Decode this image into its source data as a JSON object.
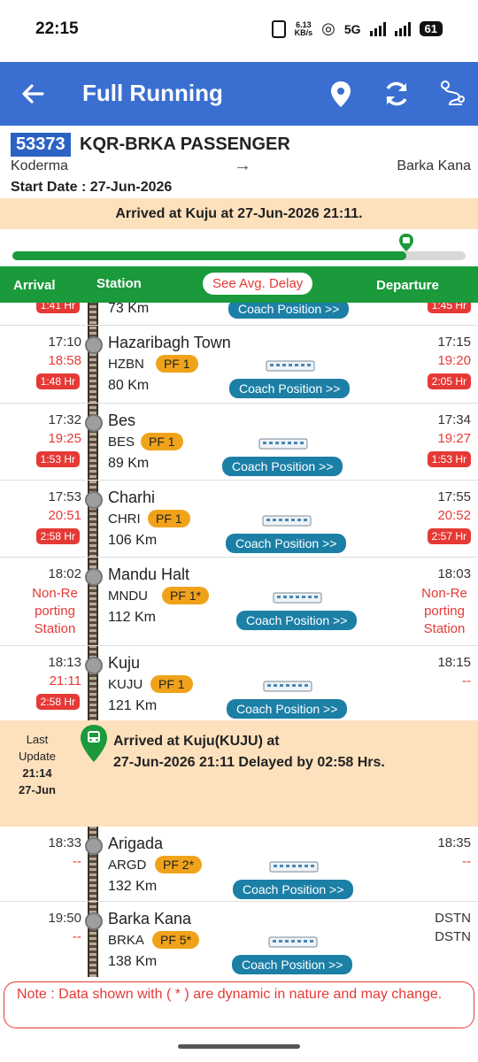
{
  "status_bar": {
    "time": "22:15",
    "net_speed": "6.13",
    "net_unit": "KB/s",
    "network": "5G",
    "battery": "61"
  },
  "app_bar": {
    "title": "Full Running",
    "icons": [
      "back-arrow-icon",
      "location-pin-icon",
      "refresh-icon",
      "route-map-icon"
    ]
  },
  "train": {
    "number": "53373",
    "name": "KQR-BRKA PASSENGER",
    "from": "Koderma",
    "to": "Barka Kana",
    "start_date": "Start Date : 27-Jun-2026"
  },
  "banner": "Arrived at Kuju at 27-Jun-2026 21:11.",
  "progress": {
    "fraction": 0.87
  },
  "columns": {
    "arrival": "Arrival",
    "station": "Station",
    "avg_delay": "See Avg. Delay",
    "departure": "Departure"
  },
  "partial_row": {
    "delay_arr": "1:41 Hr",
    "km": "73 Km",
    "coach": "Coach Position >>",
    "delay_dep": "1:45 Hr"
  },
  "stations": [
    {
      "sched_arr": "17:10",
      "act_arr": "18:58",
      "delay_arr": "1:48 Hr",
      "name": "Hazaribagh Town",
      "code": "HZBN",
      "pf": "PF 1",
      "km": "80 Km",
      "coach": "Coach Position >>",
      "sched_dep": "17:15",
      "act_dep": "19:20",
      "delay_dep": "2:05 Hr"
    },
    {
      "sched_arr": "17:32",
      "act_arr": "19:25",
      "delay_arr": "1:53 Hr",
      "name": "Bes",
      "code": "BES",
      "pf": "PF 1",
      "km": "89 Km",
      "coach": "Coach Position >>",
      "sched_dep": "17:34",
      "act_dep": "19:27",
      "delay_dep": "1:53 Hr"
    },
    {
      "sched_arr": "17:53",
      "act_arr": "20:51",
      "delay_arr": "2:58 Hr",
      "name": "Charhi",
      "code": "CHRI",
      "pf": "PF 1",
      "km": "106 Km",
      "coach": "Coach Position >>",
      "sched_dep": "17:55",
      "act_dep": "20:52",
      "delay_dep": "2:57 Hr"
    },
    {
      "sched_arr": "18:02",
      "nonrep_arr": [
        "Non-Re",
        "porting",
        "Station"
      ],
      "name": "Mandu Halt",
      "code": "MNDU",
      "pf": "PF 1*",
      "km": "112 Km",
      "coach": "Coach Position >>",
      "sched_dep": "18:03",
      "nonrep_dep": [
        "Non-Re",
        "porting",
        "Station"
      ]
    },
    {
      "sched_arr": "18:13",
      "act_arr": "21:11",
      "delay_arr": "2:58 Hr",
      "name": "Kuju",
      "code": "KUJU",
      "pf": "PF 1",
      "km": "121 Km",
      "coach": "Coach Position >>",
      "sched_dep": "18:15",
      "act_dep": "--"
    },
    {
      "sched_arr": "18:33",
      "act_arr": "--",
      "name": "Arigada",
      "code": "ARGD",
      "pf": "PF 2*",
      "km": "132 Km",
      "coach": "Coach Position >>",
      "sched_dep": "18:35",
      "act_dep": "--"
    },
    {
      "sched_arr": "19:50",
      "act_arr": "--",
      "name": "Barka Kana",
      "code": "BRKA",
      "pf": "PF 5*",
      "km": "138 Km",
      "coach": "Coach Position >>",
      "sched_dep": "DSTN",
      "act_dep": "DSTN"
    }
  ],
  "last_update": {
    "label1": "Last",
    "label2": "Update",
    "time": "21:14",
    "date": "27-Jun",
    "line1": "Arrived at Kuju(KUJU) at",
    "line2": "27-Jun-2026 21:11 Delayed by 02:58 Hrs."
  },
  "note": "Note : Data shown with ( * ) are dynamic in nature and may change.",
  "colors": {
    "app_bar": "#3a6fd1",
    "green": "#1a9a3b",
    "red": "#e53935",
    "orange_pf": "#f0a31a",
    "coach_btn": "#1c7fa6",
    "banner": "#fde1bd"
  }
}
